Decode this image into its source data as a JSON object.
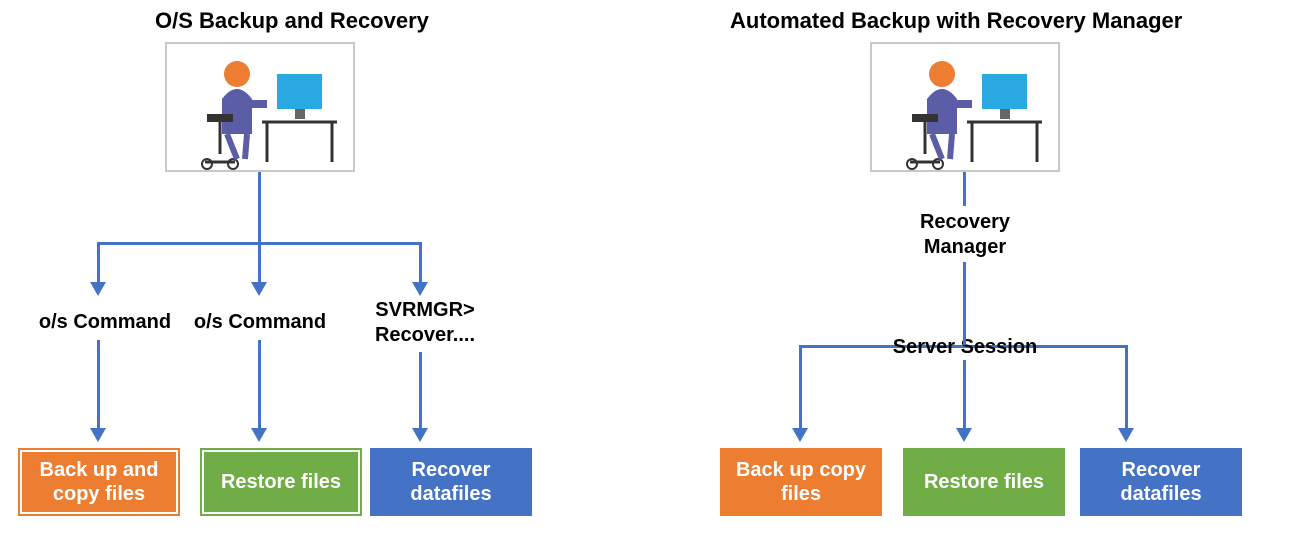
{
  "left": {
    "title": "O/S Backup and Recovery",
    "cmd1": "o/s Command",
    "cmd2": "o/s Command",
    "cmd3": "SVRMGR>\nRecover....",
    "box1": "Back up and copy files",
    "box2": "Restore files",
    "box3": "Recover datafiles"
  },
  "right": {
    "title": "Automated Backup with Recovery Manager",
    "rm": "Recovery Manager",
    "session": "Server Session",
    "box1": "Back up copy files",
    "box2": "Restore files",
    "box3": "Recover datafiles"
  }
}
